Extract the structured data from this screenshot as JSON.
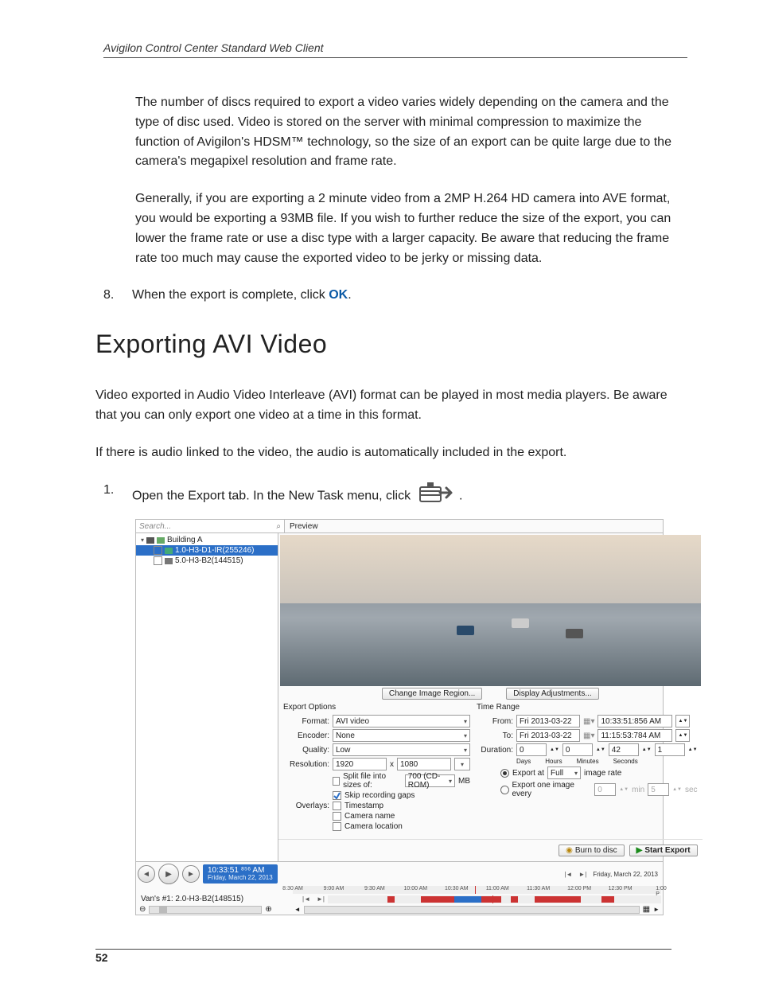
{
  "doc": {
    "running_header": "Avigilon Control Center Standard Web Client",
    "page_number": "52",
    "para1": "The number of discs required to export a video varies widely depending on the camera and the type of disc used. Video is stored on the server with minimal compression to maximize the function of Avigilon's HDSM™ technology, so the size of an export can be quite large due to the camera's megapixel resolution and frame rate.",
    "para2": "Generally, if you are exporting a 2 minute video from a 2MP H.264 HD camera into AVE format, you would be exporting a 93MB file. If you wish to further reduce the size of the export, you can lower the frame rate or use a disc type with a larger capacity. Be aware that reducing the frame rate too much may cause the exported video to be jerky or missing data.",
    "step8_num": "8.",
    "step8_a": "When the export is complete, click ",
    "step8_b": "OK",
    "step8_c": ".",
    "h1": "Exporting AVI Video",
    "para3": "Video exported in Audio Video Interleave (AVI) format can be played in most media players. Be aware that you can only export one video at a time in this format.",
    "para4": "If there is audio linked to the video, the audio is automatically included in the export.",
    "step1_num": "1.",
    "step1_a": "Open the Export tab. In the New Task menu, click ",
    "step1_b": "."
  },
  "ui": {
    "search_placeholder": "Search...",
    "preview_label": "Preview",
    "tree": {
      "site": "Building A",
      "cam1": "1.0-H3-D1-IR(255246)",
      "cam2": "5.0-H3-B2(144515)"
    },
    "change_region_btn": "Change Image Region...",
    "display_adj_btn": "Display Adjustments...",
    "export_options_title": "Export Options",
    "time_range_title": "Time Range",
    "labels": {
      "format": "Format:",
      "encoder": "Encoder:",
      "quality": "Quality:",
      "resolution": "Resolution:",
      "split": "Split file into sizes of:",
      "skip": "Skip recording gaps",
      "overlays": "Overlays:",
      "timestamp": "Timestamp",
      "camname": "Camera name",
      "camloc": "Camera location",
      "from": "From:",
      "to": "To:",
      "duration": "Duration:",
      "days": "Days",
      "hours": "Hours",
      "minutes": "Minutes",
      "seconds": "Seconds",
      "export_at": "Export at",
      "image_rate": "image rate",
      "export_one": "Export one image every",
      "min": "min",
      "sec": "sec"
    },
    "values": {
      "format": "AVI video",
      "encoder": "None",
      "quality": "Low",
      "res_w": "1920",
      "res_x": "x",
      "res_h": "1080",
      "split_size": "700 (CD-ROM)",
      "mb": "MB",
      "from_date": "Fri 2013-03-22",
      "from_time": "10:33:51:856 AM",
      "to_date": "Fri 2013-03-22",
      "to_time": "11:15:53:784 AM",
      "d_days": "0",
      "d_hours": "0",
      "d_min": "42",
      "d_sec": "1",
      "full": "Full",
      "one_min": "0",
      "one_sec": "5"
    },
    "burn_btn": "Burn to disc",
    "start_btn": "Start Export",
    "timeline": {
      "current_time": "10:33:51 ⁸⁵⁶ AM",
      "current_date": "Friday, March 22, 2013",
      "ruler_date": "Friday, March 22, 2013",
      "ticks": [
        "8:30 AM",
        "9:00 AM",
        "9:30 AM",
        "10:00 AM",
        "10:30 AM",
        "11:00 AM",
        "11:30 AM",
        "12:00 PM",
        "12:30 PM",
        "1:00 P"
      ],
      "track_label": "Van's #1: 2.0-H3-B2(148515)"
    }
  }
}
